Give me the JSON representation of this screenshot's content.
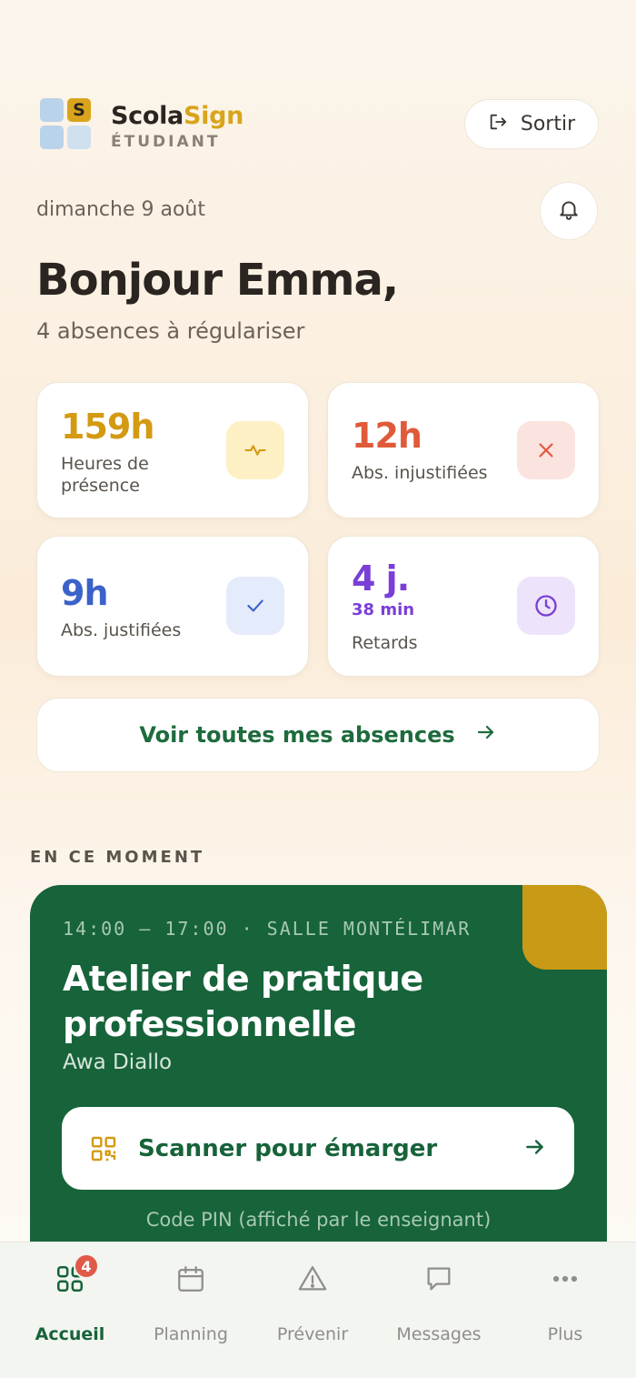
{
  "header": {
    "brand_part1": "Scola",
    "brand_part2": "Sign",
    "brand_logo_letter": "S",
    "brand_sub": "ÉTUDIANT",
    "logout_label": "Sortir",
    "colors": {
      "accent_gold": "#d9a41c",
      "brand_green": "#17633a"
    }
  },
  "welcome": {
    "date": "dimanche 9 août",
    "greeting": "Bonjour Emma,",
    "subtitle": "4 absences à régulariser"
  },
  "stats": [
    {
      "value": "159h",
      "label": "Heures de présence",
      "icon": "pulse-icon",
      "color": "#d39a12"
    },
    {
      "value": "12h",
      "label": "Abs. injustifiées",
      "icon": "close-icon",
      "color": "#e05a3a"
    },
    {
      "value": "9h",
      "label": "Abs. justifiées",
      "icon": "check-icon",
      "color": "#3b62c9"
    },
    {
      "value": "4 j.",
      "sub_value": "38 min",
      "label": "Retards",
      "icon": "clock-icon",
      "color": "#7a3fd6"
    }
  ],
  "all_absences_label": "Voir toutes mes absences",
  "current": {
    "section_title": "EN CE MOMENT",
    "time_room": "14:00 — 17:00 · SALLE MONTÉLIMAR",
    "course": "Atelier de pratique professionnelle",
    "teacher": "Awa Diallo",
    "scan_label": "Scanner pour émarger",
    "pin_text": "Code PIN (affiché par le enseignant)"
  },
  "nav": {
    "items": [
      {
        "label": "Accueil",
        "icon": "home-grid-icon",
        "active": true,
        "badge": "4"
      },
      {
        "label": "Planning",
        "icon": "calendar-icon"
      },
      {
        "label": "Prévenir",
        "icon": "warning-icon"
      },
      {
        "label": "Messages",
        "icon": "message-icon"
      },
      {
        "label": "Plus",
        "icon": "more-icon"
      }
    ]
  }
}
